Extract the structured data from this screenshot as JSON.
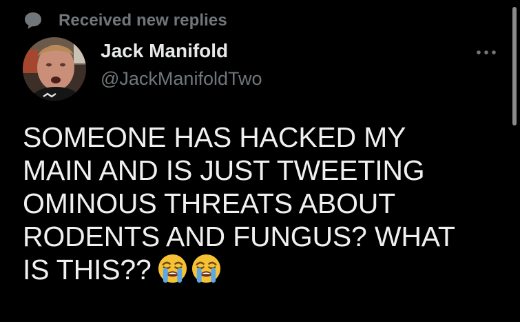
{
  "context": {
    "icon": "speech-bubble-icon",
    "label": "Received new replies"
  },
  "author": {
    "name": "Jack Manifold",
    "handle": "@JackManifoldTwo",
    "avatar": "profile-photo"
  },
  "tweet": {
    "lines": [
      "SOMEONE HAS HACKED MY",
      "MAIN AND IS JUST TWEETING",
      "OMINOUS THREATS ABOUT",
      "RODENTS AND FUNGUS? WHAT",
      "IS THIS??"
    ],
    "emojis": [
      "loudly-crying-face",
      "loudly-crying-face"
    ]
  },
  "more_menu": {
    "icon": "more-horizontal-icon"
  },
  "colors": {
    "background": "#000000",
    "primary_text": "#e7e9ea",
    "secondary_text": "#71767b",
    "emoji_face": "#f6c134",
    "emoji_tears": "#5aa9e6"
  }
}
